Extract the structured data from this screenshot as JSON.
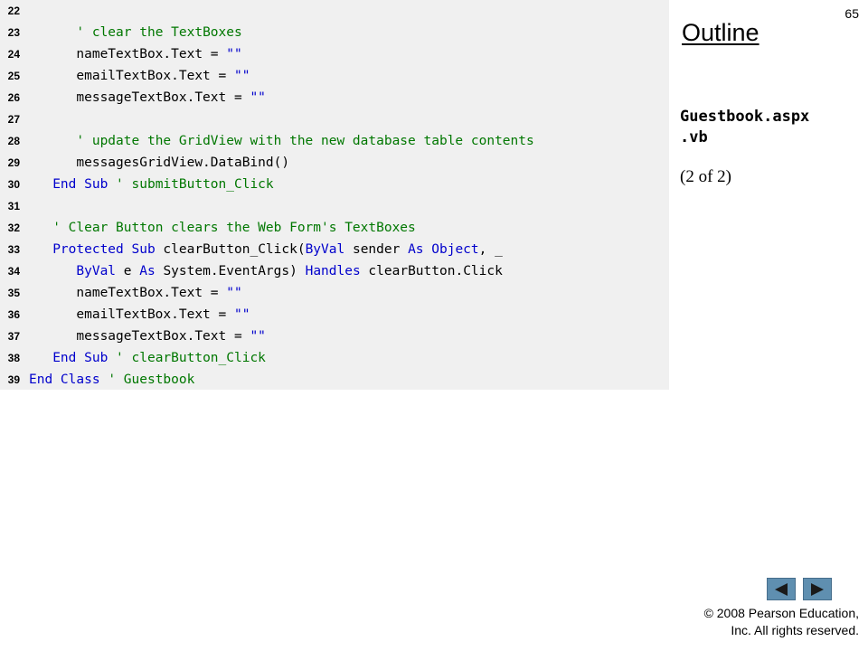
{
  "header": {
    "page_number": "65",
    "outline_title": "Outline",
    "file_name_line1": "Guestbook.aspx",
    "file_name_line2": ".vb",
    "page_of": "(2 of 2)"
  },
  "code": {
    "lines": [
      {
        "num": "22",
        "tokens": []
      },
      {
        "num": "23",
        "tokens": [
          {
            "t": "      ",
            "c": "plain"
          },
          {
            "t": "' clear the TextBoxes",
            "c": "cm"
          }
        ]
      },
      {
        "num": "24",
        "tokens": [
          {
            "t": "      nameTextBox.Text = ",
            "c": "plain"
          },
          {
            "t": "\"\"",
            "c": "str"
          }
        ]
      },
      {
        "num": "25",
        "tokens": [
          {
            "t": "      emailTextBox.Text = ",
            "c": "plain"
          },
          {
            "t": "\"\"",
            "c": "str"
          }
        ]
      },
      {
        "num": "26",
        "tokens": [
          {
            "t": "      messageTextBox.Text = ",
            "c": "plain"
          },
          {
            "t": "\"\"",
            "c": "str"
          }
        ]
      },
      {
        "num": "27",
        "tokens": []
      },
      {
        "num": "28",
        "tokens": [
          {
            "t": "      ",
            "c": "plain"
          },
          {
            "t": "' update the GridView with the new database table contents",
            "c": "cm"
          }
        ]
      },
      {
        "num": "29",
        "tokens": [
          {
            "t": "      messagesGridView.DataBind()",
            "c": "plain"
          }
        ]
      },
      {
        "num": "30",
        "tokens": [
          {
            "t": "   ",
            "c": "plain"
          },
          {
            "t": "End Sub",
            "c": "kw"
          },
          {
            "t": " ",
            "c": "plain"
          },
          {
            "t": "' submitButton_Click",
            "c": "cm"
          }
        ]
      },
      {
        "num": "31",
        "tokens": []
      },
      {
        "num": "32",
        "tokens": [
          {
            "t": "   ",
            "c": "plain"
          },
          {
            "t": "' Clear Button clears the Web Form's TextBoxes",
            "c": "cm"
          }
        ]
      },
      {
        "num": "33",
        "tokens": [
          {
            "t": "   ",
            "c": "plain"
          },
          {
            "t": "Protected Sub",
            "c": "kw"
          },
          {
            "t": " clearButton_Click(",
            "c": "plain"
          },
          {
            "t": "ByVal",
            "c": "kw"
          },
          {
            "t": " sender ",
            "c": "plain"
          },
          {
            "t": "As Object",
            "c": "kw"
          },
          {
            "t": ", _",
            "c": "plain"
          }
        ]
      },
      {
        "num": "34",
        "tokens": [
          {
            "t": "      ",
            "c": "plain"
          },
          {
            "t": "ByVal",
            "c": "kw"
          },
          {
            "t": " e ",
            "c": "plain"
          },
          {
            "t": "As",
            "c": "kw"
          },
          {
            "t": " System.EventArgs) ",
            "c": "plain"
          },
          {
            "t": "Handles",
            "c": "kw"
          },
          {
            "t": " clearButton.Click",
            "c": "plain"
          }
        ]
      },
      {
        "num": "35",
        "tokens": [
          {
            "t": "      nameTextBox.Text = ",
            "c": "plain"
          },
          {
            "t": "\"\"",
            "c": "str"
          }
        ]
      },
      {
        "num": "36",
        "tokens": [
          {
            "t": "      emailTextBox.Text = ",
            "c": "plain"
          },
          {
            "t": "\"\"",
            "c": "str"
          }
        ]
      },
      {
        "num": "37",
        "tokens": [
          {
            "t": "      messageTextBox.Text = ",
            "c": "plain"
          },
          {
            "t": "\"\"",
            "c": "str"
          }
        ]
      },
      {
        "num": "38",
        "tokens": [
          {
            "t": "   ",
            "c": "plain"
          },
          {
            "t": "End Sub",
            "c": "kw"
          },
          {
            "t": " ",
            "c": "plain"
          },
          {
            "t": "' clearButton_Click",
            "c": "cm"
          }
        ]
      },
      {
        "num": "39",
        "tokens": [
          {
            "t": "End Class",
            "c": "kw"
          },
          {
            "t": " ",
            "c": "plain"
          },
          {
            "t": "' Guestbook",
            "c": "cm"
          }
        ]
      }
    ]
  },
  "nav": {
    "prev_icon": "triangle-left-icon",
    "next_icon": "triangle-right-icon"
  },
  "footer": {
    "copyright_line1": "© 2008 Pearson Education,",
    "copyright_line2": "Inc.  All rights reserved."
  },
  "colors": {
    "keyword": "#0000cc",
    "comment": "#007700",
    "string": "#0000cc",
    "code_background": "#f0f0f0",
    "nav_button": "#5f8fb0"
  }
}
